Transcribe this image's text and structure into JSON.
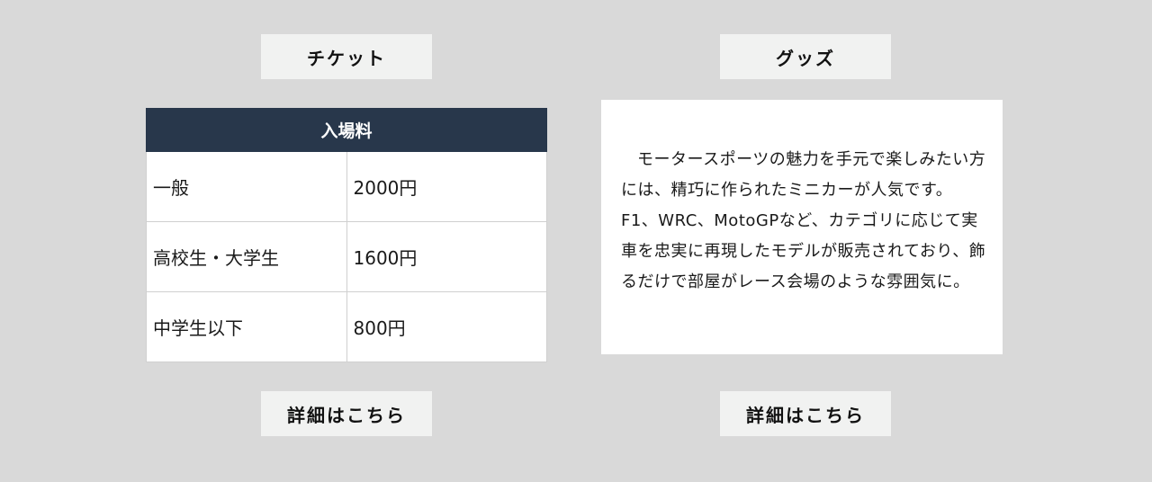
{
  "ticket": {
    "title": "チケット",
    "table": {
      "header": "入場料",
      "rows": [
        {
          "category": "一般",
          "price": "2000円"
        },
        {
          "category": "高校生・大学生",
          "price": "1600円"
        },
        {
          "category": "中学生以下",
          "price": "800円"
        }
      ]
    },
    "more_label": "詳細はこちら"
  },
  "goods": {
    "title": "グッズ",
    "description": "モータースポーツの魅力を手元で楽しみたい方には、精巧に作られたミニカーが人気です。F1、WRC、MotoGPなど、カテゴリに応じて実車を忠実に再現したモデルが販売されており、飾るだけで部屋がレース会場のような雰囲気に。",
    "more_label": "詳細はこちら"
  },
  "colors": {
    "background": "#d9d9d9",
    "label_box": "#f1f2f1",
    "table_header": "#28374b",
    "card": "#ffffff"
  }
}
